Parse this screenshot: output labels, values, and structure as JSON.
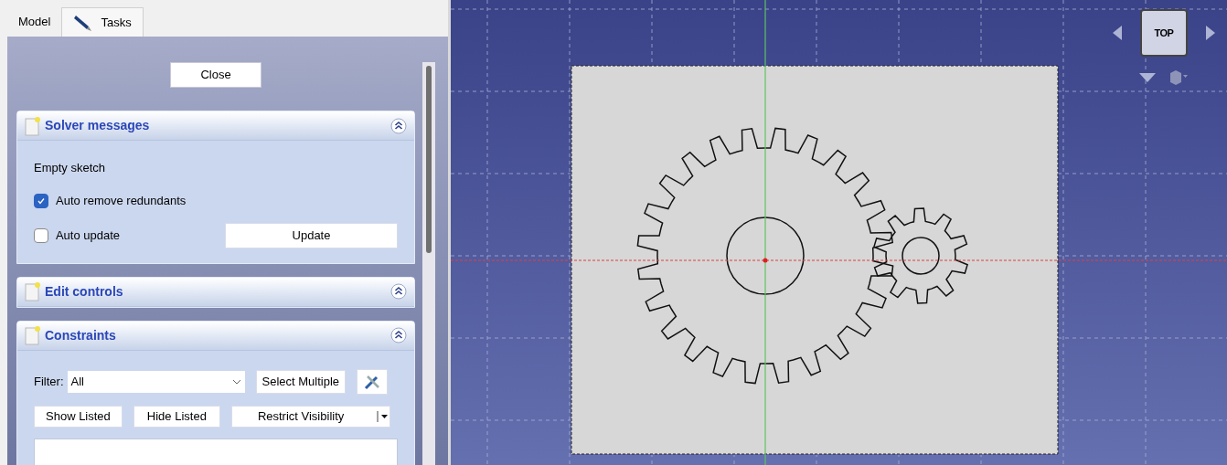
{
  "tabs": [
    {
      "label": "Model",
      "selected": false
    },
    {
      "label": "Tasks",
      "selected": true
    }
  ],
  "close_button": "Close",
  "solver_messages": {
    "title": "Solver messages",
    "status": "Empty sketch",
    "options": [
      {
        "label": "Auto remove redundants",
        "checked": true
      },
      {
        "label": "Auto update",
        "checked": false
      }
    ],
    "update_button": "Update"
  },
  "edit_controls": {
    "title": "Edit controls"
  },
  "constraints": {
    "title": "Constraints",
    "filter_label": "Filter:",
    "filter_value": "All",
    "select_multiple_button": "Select Multiple",
    "show_listed_button": "Show Listed",
    "hide_listed_button": "Hide Listed",
    "restrict_visibility_button": "Restrict Visibility"
  },
  "navigation_cube": {
    "face": "TOP"
  }
}
